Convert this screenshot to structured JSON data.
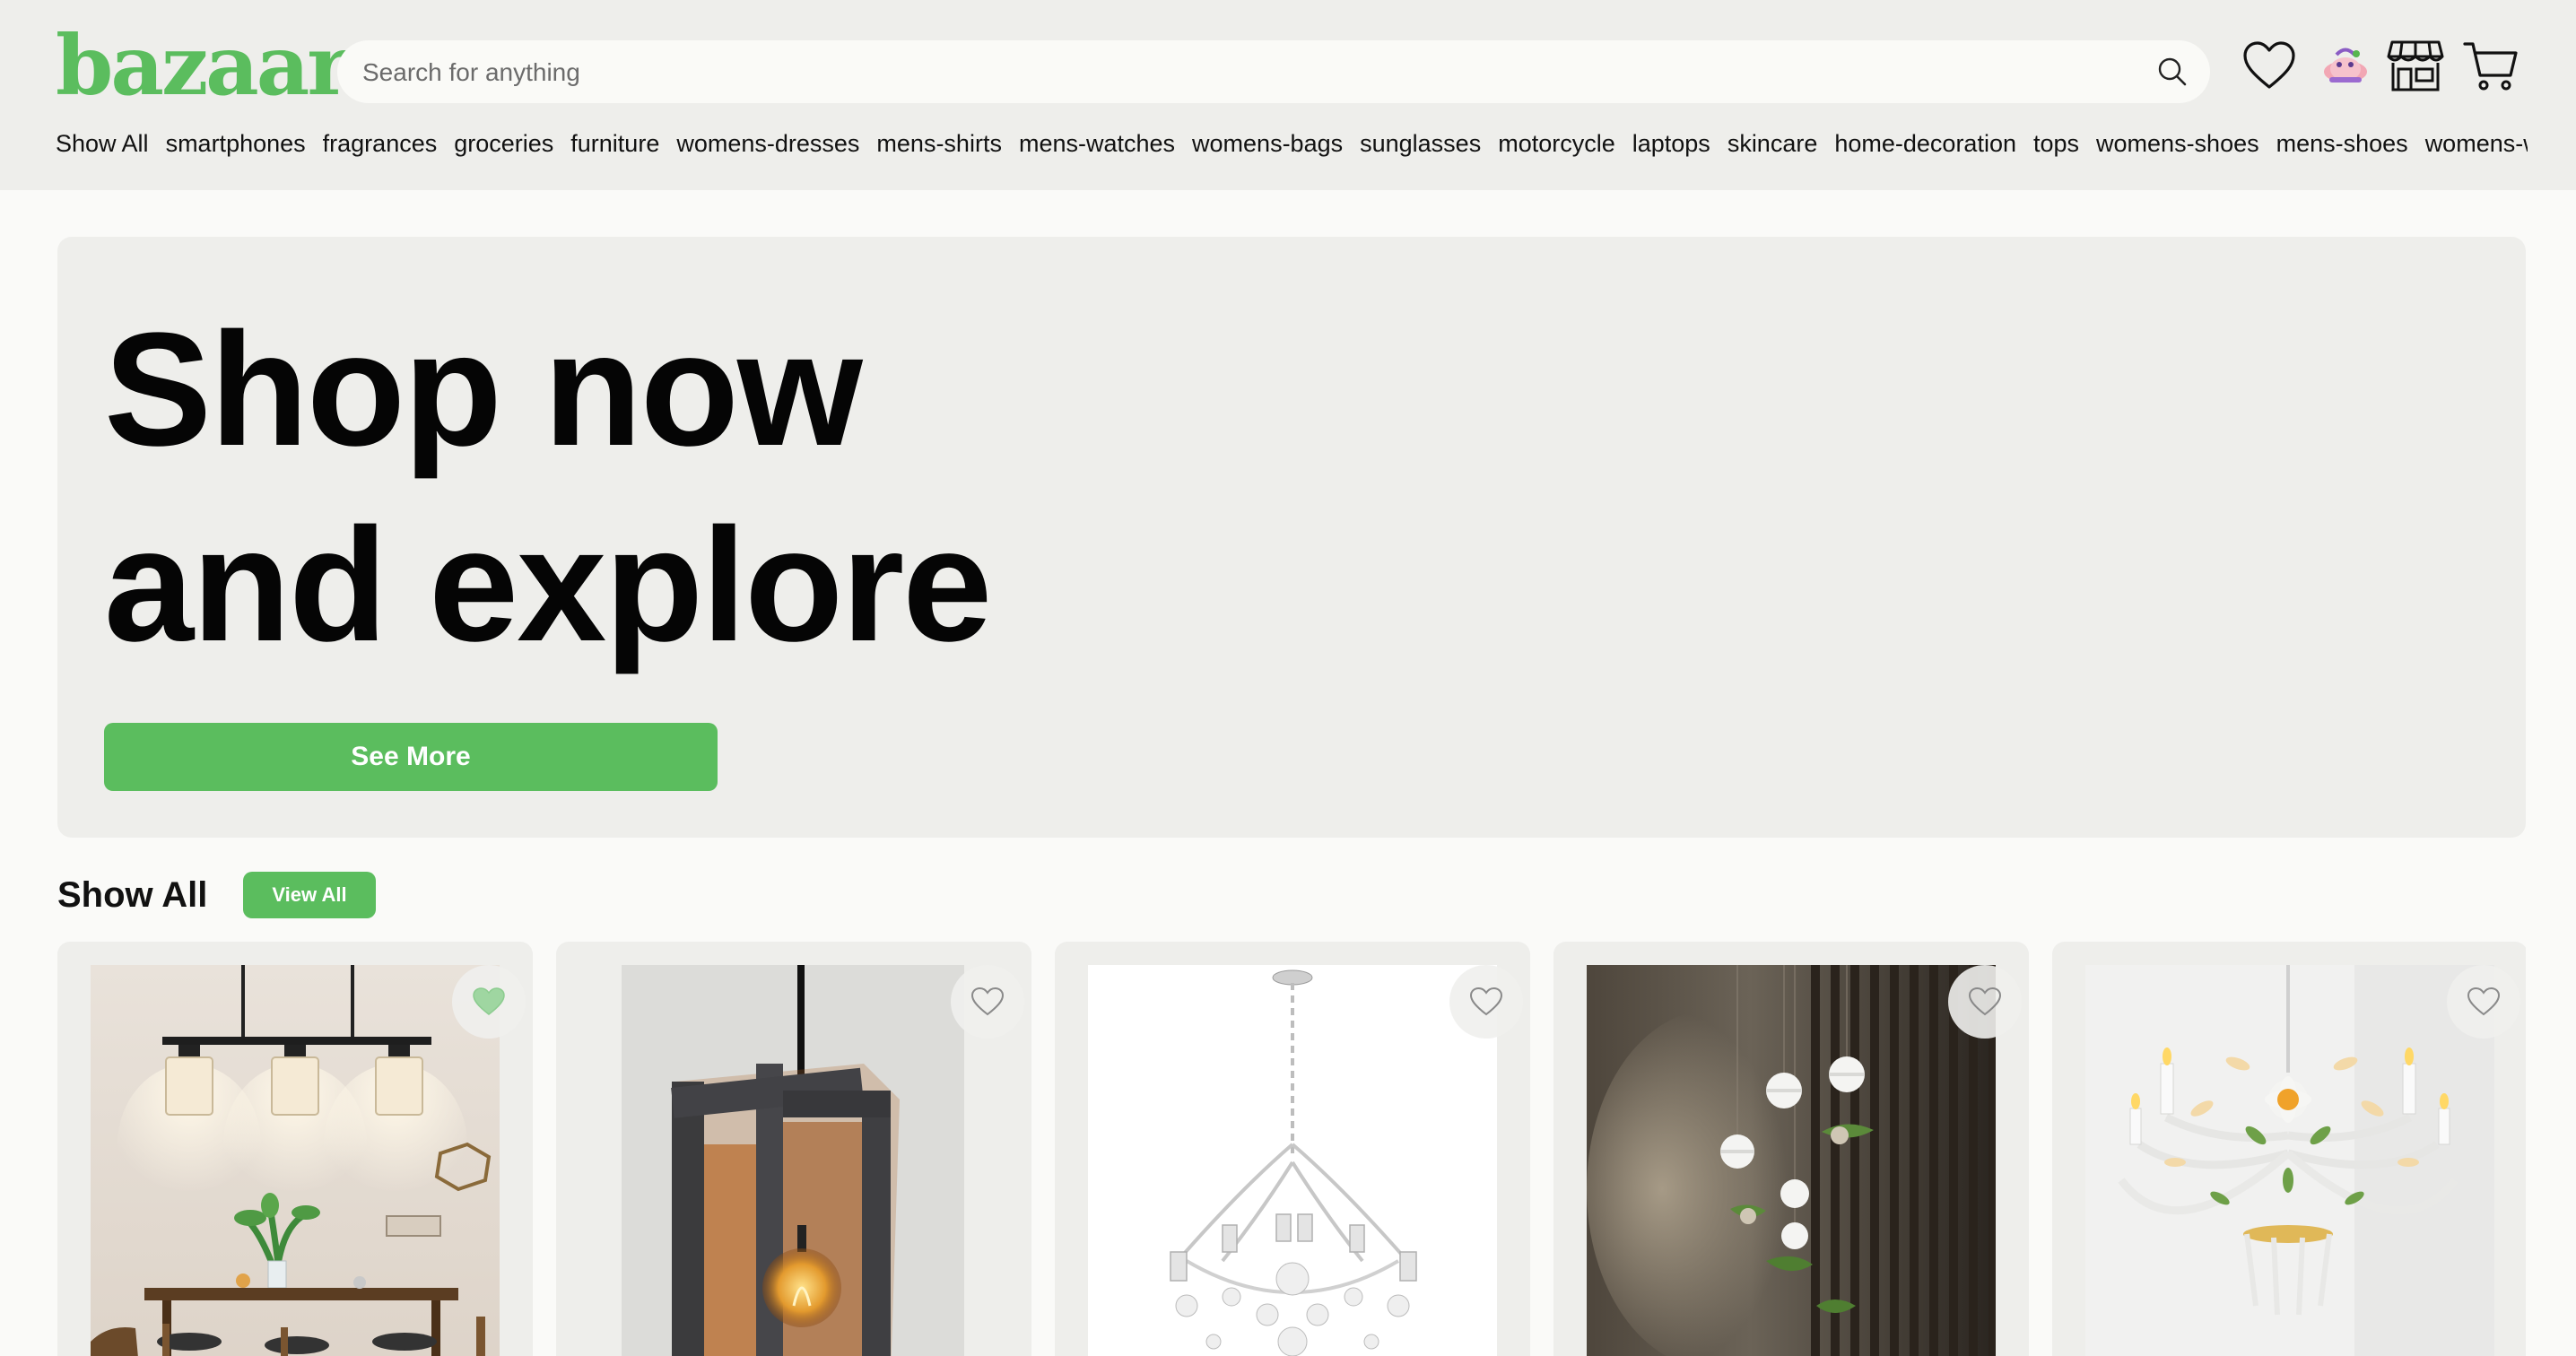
{
  "brand": {
    "logo": "bazaar",
    "accent": "#5bbd5e"
  },
  "search": {
    "placeholder": "Search for anything",
    "value": ""
  },
  "header_icons": [
    "search-icon",
    "heart-icon",
    "avatar",
    "store-icon",
    "cart-icon"
  ],
  "categories": [
    "Show All",
    "smartphones",
    "fragrances",
    "groceries",
    "furniture",
    "womens-dresses",
    "mens-shirts",
    "mens-watches",
    "womens-bags",
    "sunglasses",
    "motorcycle",
    "laptops",
    "skincare",
    "home-decoration",
    "tops",
    "womens-shoes",
    "mens-shoes",
    "womens-watches"
  ],
  "hero": {
    "title_line1": "Shop now",
    "title_line2": "and explore",
    "button": "See More"
  },
  "section": {
    "title": "Show All",
    "button": "View All"
  },
  "products": [
    {
      "image": "dining-room-pendant-light",
      "favorited": true
    },
    {
      "image": "wooden-cage-pendant-lamp",
      "favorited": false
    },
    {
      "image": "crystal-chandelier",
      "favorited": false
    },
    {
      "image": "globe-pendant-lights-with-plants",
      "favorited": false
    },
    {
      "image": "floral-chandelier",
      "favorited": false
    }
  ]
}
